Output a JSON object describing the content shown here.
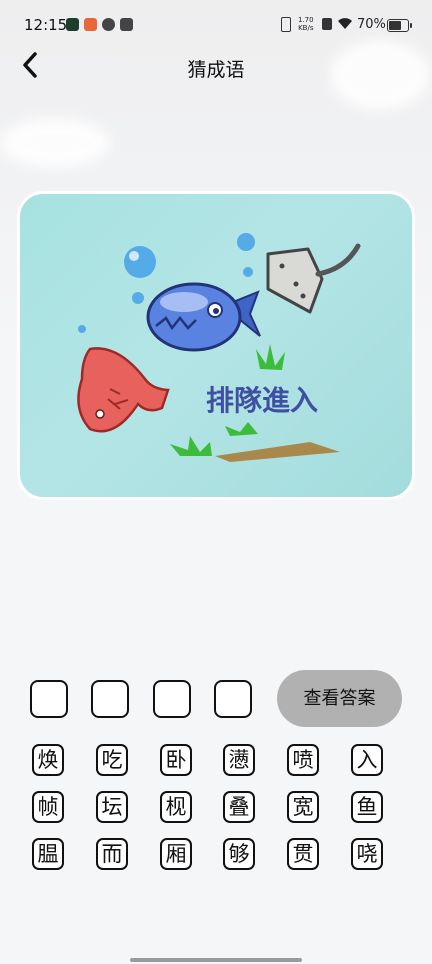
{
  "status_bar": {
    "time": "12:15",
    "net_speed_value": "1.70",
    "net_speed_unit": "KB/s",
    "battery_percent": "70%",
    "battery_level": 0.7
  },
  "header": {
    "title": "猜成语"
  },
  "puzzle": {
    "image_text": "排隊進入"
  },
  "answer": {
    "slots": 4,
    "reveal_label": "查看答案"
  },
  "candidates": [
    [
      "焕",
      "吃",
      "卧",
      "懑",
      "喷",
      "入"
    ],
    [
      "帧",
      "坛",
      "枧",
      "叠",
      "宽",
      "鱼"
    ],
    [
      "腽",
      "而",
      "厢",
      "够",
      "贯",
      "哓"
    ]
  ],
  "colors": {
    "reveal_button": "#b1b1b1",
    "card_bg": "#a6e2e0"
  }
}
